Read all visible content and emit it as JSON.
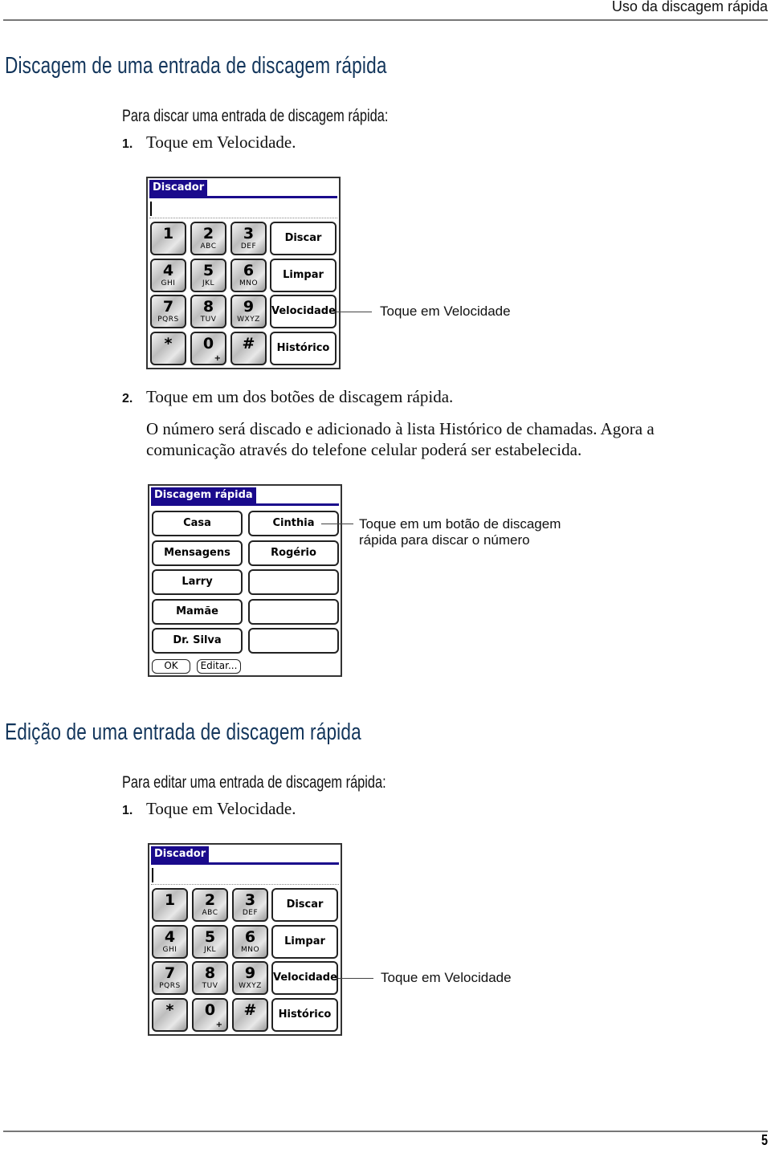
{
  "header": {
    "running_title": "Uso da discagem rápida"
  },
  "section1": {
    "heading": "Discagem de uma entrada de discagem rápida",
    "lead": "Para discar uma entrada de discagem rápida:",
    "step1": {
      "num": "1.",
      "text": "Toque em Velocidade."
    },
    "step2": {
      "num": "2.",
      "text": "Toque em um dos botões de discagem rápida."
    },
    "paragraph": "O número será discado e adicionado à lista Histórico de chamadas. Agora a comunicação através do telefone celular poderá ser estabelecida.",
    "dialer_callout": "Toque em Velocidade",
    "speed_callout_line1": "Toque em um botão de discagem",
    "speed_callout_line2": "rápida para discar o número"
  },
  "dialer": {
    "title": "Discador",
    "keys": [
      {
        "digit": "1",
        "letters": ""
      },
      {
        "digit": "2",
        "letters": "ABC"
      },
      {
        "digit": "3",
        "letters": "DEF"
      },
      {
        "digit": "4",
        "letters": "GHI"
      },
      {
        "digit": "5",
        "letters": "JKL"
      },
      {
        "digit": "6",
        "letters": "MNO"
      },
      {
        "digit": "7",
        "letters": "PQRS"
      },
      {
        "digit": "8",
        "letters": "TUV"
      },
      {
        "digit": "9",
        "letters": "WXYZ"
      },
      {
        "digit": "*",
        "letters": ""
      },
      {
        "digit": "0",
        "letters": "",
        "extra": "+"
      },
      {
        "digit": "#",
        "letters": ""
      }
    ],
    "functions": [
      "Discar",
      "Limpar",
      "Velocidade",
      "Histórico"
    ]
  },
  "speed_dial": {
    "title": "Discagem rápida",
    "left": [
      "Casa",
      "Mensagens",
      "Larry",
      "Mamãe",
      "Dr. Silva"
    ],
    "right": [
      "Cinthia",
      "Rogério",
      "",
      "",
      ""
    ],
    "ok": "OK",
    "edit": "Editar..."
  },
  "section2": {
    "heading": "Edição de uma entrada de discagem rápida",
    "lead": "Para editar uma entrada de discagem rápida:",
    "step1": {
      "num": "1.",
      "text": "Toque em Velocidade."
    },
    "dialer_callout": "Toque em Velocidade"
  },
  "footer": {
    "page_number": "5"
  }
}
